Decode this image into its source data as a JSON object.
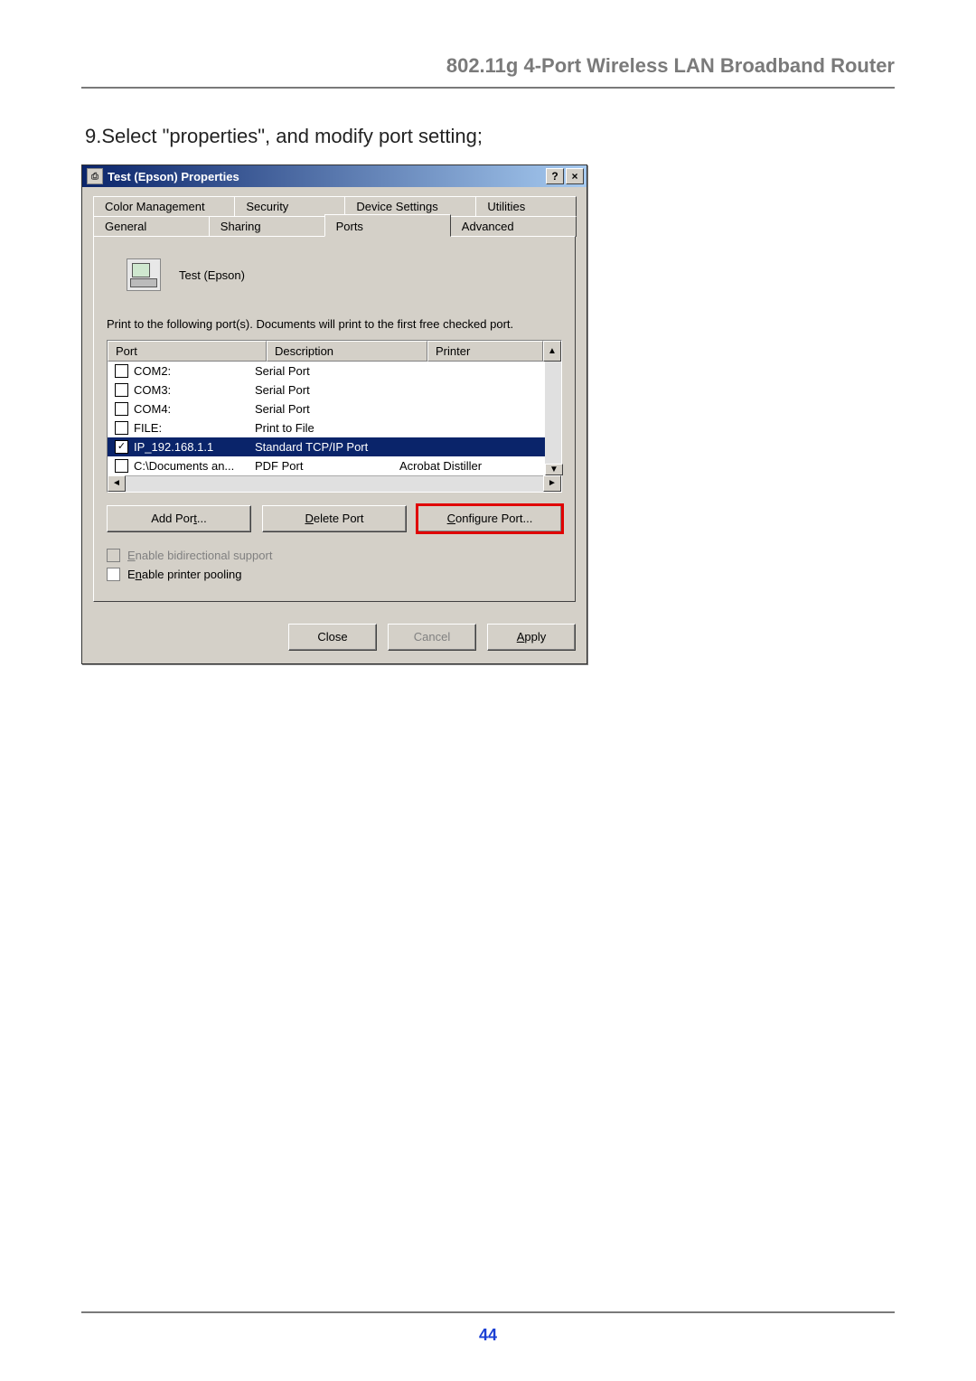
{
  "doc": {
    "header": "802.11g 4-Port Wireless LAN Broadband Router",
    "instruction": "9.Select \"properties\", and modify port setting;",
    "page_number": "44"
  },
  "dialog": {
    "title": "Test (Epson) Properties",
    "help_glyph": "?",
    "close_glyph": "×",
    "tabs_back": [
      "Color Management",
      "Security",
      "Device Settings",
      "Utilities"
    ],
    "tabs_front": [
      "General",
      "Sharing",
      "Ports",
      "Advanced"
    ],
    "active_tab": "Ports",
    "printer_name": "Test (Epson)",
    "explain": "Print to the following port(s). Documents will print to the first free checked port.",
    "columns": {
      "port": "Port",
      "desc": "Description",
      "printer": "Printer"
    },
    "rows": [
      {
        "checked": false,
        "port": "COM2:",
        "desc": "Serial Port",
        "printer": "",
        "selected": false
      },
      {
        "checked": false,
        "port": "COM3:",
        "desc": "Serial Port",
        "printer": "",
        "selected": false
      },
      {
        "checked": false,
        "port": "COM4:",
        "desc": "Serial Port",
        "printer": "",
        "selected": false
      },
      {
        "checked": false,
        "port": "FILE:",
        "desc": "Print to File",
        "printer": "",
        "selected": false
      },
      {
        "checked": true,
        "port": "IP_192.168.1.1",
        "desc": "Standard TCP/IP Port",
        "printer": "",
        "selected": true
      },
      {
        "checked": false,
        "port": "C:\\Documents an...",
        "desc": "PDF Port",
        "printer": "Acrobat Distiller",
        "selected": false
      }
    ],
    "buttons": {
      "add": "Add Port...",
      "delete": "Delete Port",
      "configure": "Configure Port..."
    },
    "options": {
      "bidi": "Enable bidirectional support",
      "pool": "Enable printer pooling"
    },
    "dlg_buttons": {
      "close": "Close",
      "cancel": "Cancel",
      "apply": "Apply"
    },
    "underline": {
      "add": "t",
      "delete": "D",
      "configure": "C",
      "bidi": "E",
      "pool": "n",
      "apply": "A",
      "print_to": "P"
    }
  }
}
